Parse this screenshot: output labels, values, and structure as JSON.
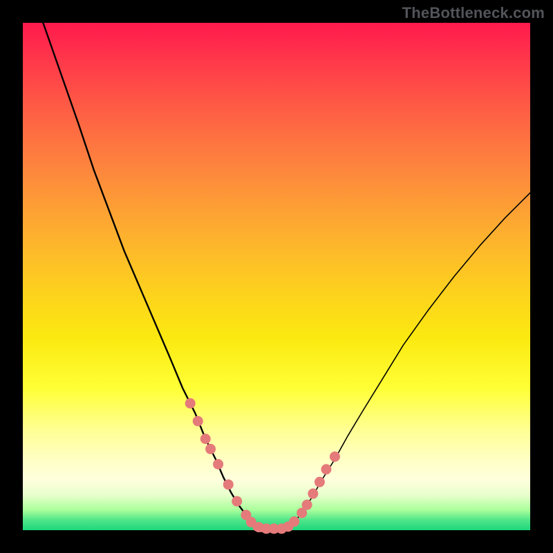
{
  "watermark": "TheBottleneck.com",
  "chart_data": {
    "type": "line",
    "title": "",
    "xlabel": "",
    "ylabel": "",
    "xlim": [
      0,
      100
    ],
    "ylim": [
      0,
      100
    ],
    "series": [
      {
        "name": "left_curve",
        "x": [
          4,
          7.5,
          11,
          14,
          17,
          20,
          23,
          26,
          29,
          31.5,
          34,
          36,
          38,
          39.5,
          41,
          42.5,
          44,
          45,
          46
        ],
        "y": [
          100,
          90,
          80,
          71,
          63,
          55,
          48,
          41,
          34,
          28,
          23,
          18,
          14,
          10.5,
          7.5,
          5,
          3,
          1.5,
          0.5
        ]
      },
      {
        "name": "flat_min",
        "x": [
          46,
          47,
          48,
          49,
          50,
          51,
          52
        ],
        "y": [
          0.5,
          0.3,
          0.2,
          0.2,
          0.2,
          0.3,
          0.5
        ]
      },
      {
        "name": "right_curve",
        "x": [
          52,
          53.5,
          55,
          57,
          59,
          61.5,
          64,
          67,
          71,
          75,
          80,
          85,
          90,
          95,
          100
        ],
        "y": [
          0.5,
          1.5,
          3.5,
          6.5,
          10,
          14,
          18.5,
          23.5,
          30,
          36.5,
          43.5,
          50,
          56,
          61.5,
          66.5
        ]
      }
    ],
    "scatter": {
      "name": "dots",
      "color": "#e57a7a",
      "x": [
        33.0,
        34.5,
        36.0,
        37.0,
        38.5,
        40.5,
        42.2,
        44.0,
        45.0,
        46.5,
        48.0,
        49.5,
        51.0,
        52.3,
        53.5,
        55.0,
        56.0,
        57.2,
        58.5,
        59.8,
        61.5
      ],
      "y": [
        25.0,
        21.5,
        18.0,
        16.0,
        13.0,
        9.0,
        5.7,
        3.0,
        1.6,
        0.6,
        0.3,
        0.3,
        0.3,
        0.7,
        1.7,
        3.4,
        5.0,
        7.2,
        9.5,
        12.0,
        14.5
      ]
    }
  }
}
